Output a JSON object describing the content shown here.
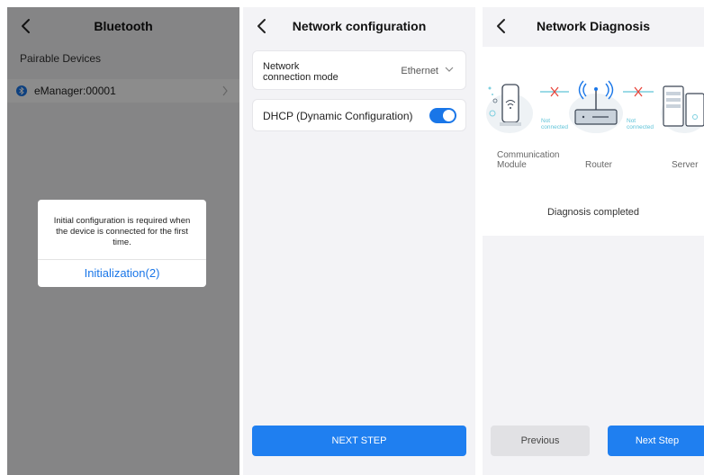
{
  "bluetooth": {
    "title": "Bluetooth",
    "section_label": "Pairable Devices",
    "device_name": "eManager:00001",
    "dialog_message": "Initial configuration is required when the device is connected for the first time.",
    "dialog_button": "Initialization(2)"
  },
  "network_config": {
    "title": "Network configuration",
    "mode_label": "Network connection mode",
    "mode_value": "Ethernet",
    "dhcp_label": "DHCP (Dynamic Configuration)",
    "dhcp_enabled": true,
    "next_button": "NEXT STEP"
  },
  "diagnosis": {
    "title": "Network Diagnosis",
    "link1_status": "Not connected",
    "link2_status": "Not connected",
    "node_module": "Communication Module",
    "node_router": "Router",
    "node_server": "Server",
    "status": "Diagnosis completed",
    "previous_button": "Previous",
    "next_button": "Next Step"
  },
  "colors": {
    "accent": "#1976e8",
    "button_blue": "#1f7ff0",
    "not_connected": "#5fc3d8",
    "error_x": "#e8463c"
  },
  "icons": [
    "back-chevron-icon",
    "bluetooth-icon",
    "chevron-right-icon",
    "chevron-down-icon",
    "toggle-switch",
    "wifi-module-icon",
    "router-icon",
    "server-icon",
    "broken-link-icon"
  ]
}
